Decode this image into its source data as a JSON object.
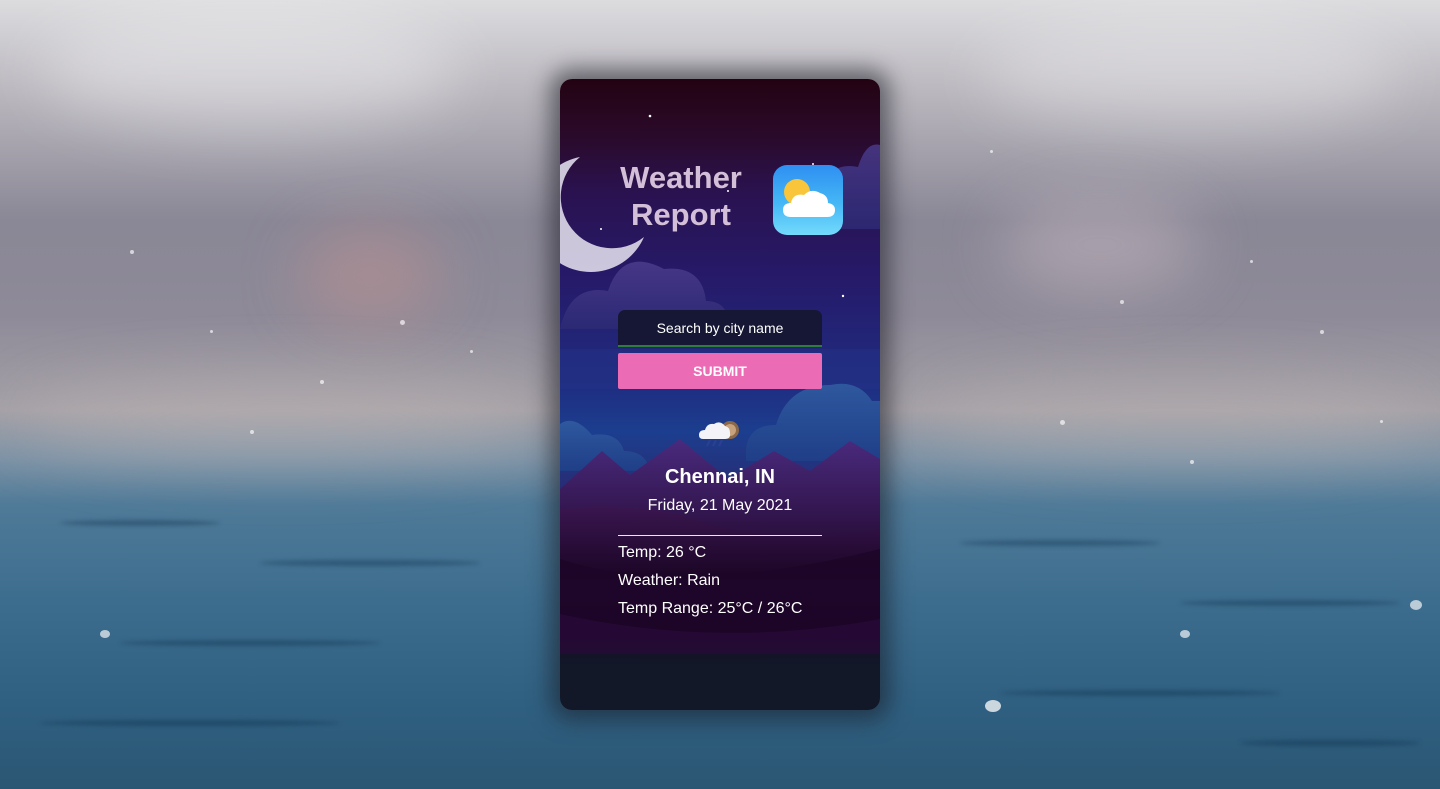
{
  "app": {
    "title_line1": "Weather",
    "title_line2": "Report",
    "app_icon": "sun-cloud-icon"
  },
  "search": {
    "placeholder": "Search by city name",
    "value": "",
    "submit_label": "SUBMIT"
  },
  "weather": {
    "icon": "rain-cloud-icon",
    "city": "Chennai, IN",
    "date": "Friday, 21 May 2021",
    "temp": "Temp: 26 °C",
    "condition": "Weather: Rain",
    "range": "Temp Range: 25°C / 26°C"
  },
  "colors": {
    "submit": "#ec6bb5",
    "search_bg": "#161734",
    "search_underline": "#2f7d3c",
    "title_text": "#d4bfd8"
  }
}
